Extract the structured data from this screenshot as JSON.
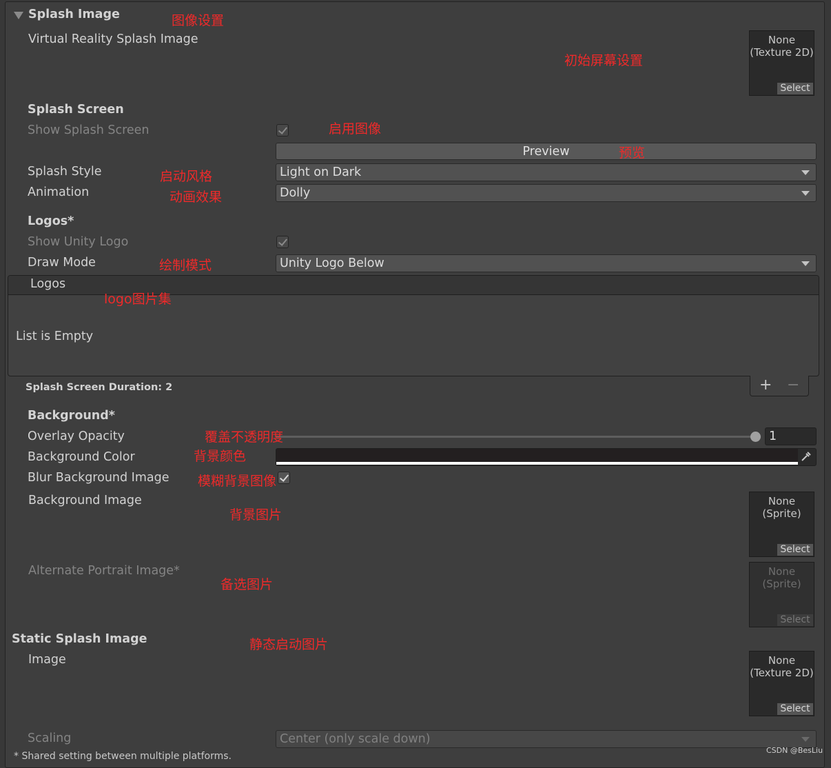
{
  "splash_image": {
    "header": "Splash Image",
    "vr_label": "Virtual Reality Splash Image",
    "vr_field": {
      "line1": "None",
      "line2": "(Texture 2D)",
      "select": "Select"
    }
  },
  "splash_screen": {
    "header": "Splash Screen",
    "show_label": "Show Splash Screen",
    "show_checked": true,
    "preview_label": "Preview",
    "style_label": "Splash Style",
    "style_value": "Light on Dark",
    "animation_label": "Animation",
    "animation_value": "Dolly"
  },
  "logos": {
    "header": "Logos*",
    "show_unity_label": "Show Unity Logo",
    "show_unity_checked": true,
    "draw_mode_label": "Draw Mode",
    "draw_mode_value": "Unity Logo Below",
    "list_header": "Logos",
    "list_empty": "List is Empty",
    "duration": "Splash Screen Duration: 2",
    "add": "+",
    "remove": "−"
  },
  "background": {
    "header": "Background*",
    "overlay_label": "Overlay Opacity",
    "overlay_value": "1",
    "overlay_fraction": 1,
    "color_label": "Background Color",
    "color_value": "#231f20",
    "blur_label": "Blur Background Image",
    "blur_checked": true,
    "image_label": "Background Image",
    "image_field": {
      "line1": "None",
      "line2": "(Sprite)",
      "select": "Select"
    },
    "portrait_label": "Alternate Portrait Image*",
    "portrait_field": {
      "line1": "None",
      "line2": "(Sprite)",
      "select": "Select"
    }
  },
  "static_splash": {
    "header": "Static Splash Image",
    "image_label": "Image",
    "image_field": {
      "line1": "None",
      "line2": "(Texture 2D)",
      "select": "Select"
    },
    "scaling_label": "Scaling",
    "scaling_value": "Center (only scale down)"
  },
  "footer_note": "* Shared setting between multiple platforms.",
  "watermark": "CSDN @BesLiu",
  "annotations": {
    "image_settings": "图像设置",
    "initial_screen": "初始屏幕设置",
    "enable_image": "启用图像",
    "preview": "预览",
    "style": "启动风格",
    "animation": "动画效果",
    "draw_mode": "绘制模式",
    "logo_set": "logo图片集",
    "overlay": "覆盖不透明度",
    "bg_color": "背景颜色",
    "blur": "模糊背景图像",
    "bg_image": "背景图片",
    "alt_image": "备选图片",
    "static": "静态启动图片"
  }
}
